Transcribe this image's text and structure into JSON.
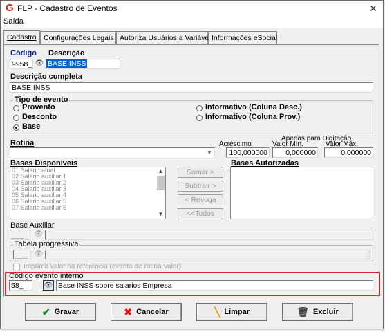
{
  "window": {
    "title": "FLP - Cadastro de Eventos",
    "close_glyph": "✕"
  },
  "menu": {
    "items": [
      "Saída"
    ]
  },
  "tabs": [
    "Cadastro",
    "Configurações Legais",
    "Autoriza Usuários a Variáveis",
    "Informações eSocial"
  ],
  "form": {
    "codigo_label": "Código",
    "descricao_label": "Descrição",
    "codigo_value": "9958_",
    "descricao_value": "BASE INSS",
    "descricao_completa_label": "Descrição completa",
    "descricao_completa_value": "BASE INSS",
    "tipo_evento": {
      "title": "Tipo de evento",
      "options": [
        "Provento",
        "Desconto",
        "Base",
        "Informativo (Coluna Desc.)",
        "Informativo (Coluna Prov.)"
      ],
      "selected": "Base"
    },
    "rotina_label": "Rotina",
    "rotina_value": "",
    "apenas_digitacao_label": "Apenas para Digitação",
    "acrescimo_label": "Acréscimo",
    "acrescimo_value": "100,000000",
    "valor_min_label": "Valor Mín.",
    "valor_min_value": "0,000000",
    "valor_max_label": "Valor Máx.",
    "valor_max_value": "0,000000",
    "bases_disponiveis_label": "Bases Disponíveis",
    "bases_disponiveis": [
      "01 Salario atual",
      "02 Salario auxiliar 1",
      "03 Salario auxiliar 2",
      "04 Salario auxiliar 3",
      "05 Salario auxiliar 4",
      "06 Salario auxiliar 5",
      "07 Salario auxiliar 6"
    ],
    "bases_autorizadas_label": "Bases Autorizadas",
    "somar_label": "Somar >",
    "subtrair_label": "Subtrair >",
    "revoga_label": "< Revoga",
    "todos_label": "<<Todos",
    "base_auxiliar_label": "Base Auxiliar",
    "base_auxiliar_value": "___",
    "tabela_progressiva_label": "Tabela progressiva",
    "tabela_progressiva_value": "___",
    "imprimir_label": "Imprimir valor na referência (evento de rotina Valor)",
    "codigo_evento_interno_label": "Código evento interno",
    "codigo_evento_interno_value": "58_",
    "codigo_evento_interno_desc": "Base INSS sobre salarios Empresa"
  },
  "buttons": {
    "gravar": "Gravar",
    "cancelar": "Cancelar",
    "limpar": "Limpar",
    "excluir": "Excluir"
  },
  "colors": {
    "highlight_border": "#d9262e",
    "selection": "#0a64c8",
    "label_blue": "#001a8c"
  },
  "icons": [
    "app-logo-icon",
    "close-icon",
    "binoculars-icon",
    "checkmark-icon",
    "x-icon",
    "broom-icon",
    "trash-icon",
    "scroll-up-icon",
    "scroll-down-icon",
    "dropdown-arrow-icon"
  ]
}
